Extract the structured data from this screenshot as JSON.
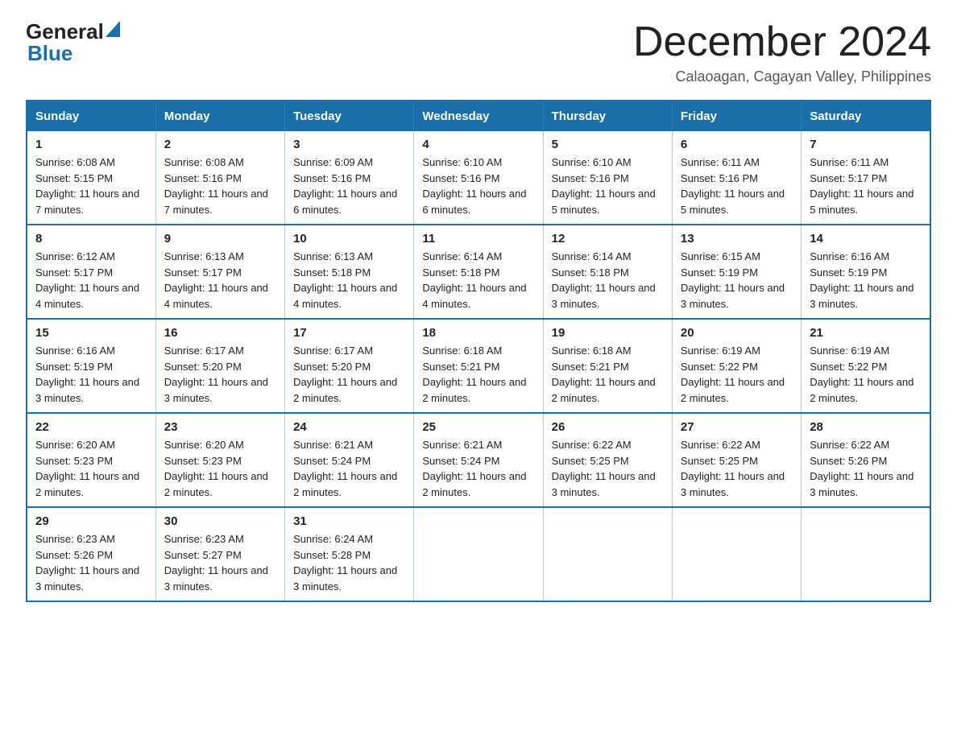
{
  "header": {
    "logo_general": "General",
    "logo_blue": "Blue",
    "month_title": "December 2024",
    "location": "Calaoagan, Cagayan Valley, Philippines"
  },
  "weekdays": [
    "Sunday",
    "Monday",
    "Tuesday",
    "Wednesday",
    "Thursday",
    "Friday",
    "Saturday"
  ],
  "weeks": [
    [
      {
        "day": "1",
        "sunrise": "6:08 AM",
        "sunset": "5:15 PM",
        "daylight": "11 hours and 7 minutes."
      },
      {
        "day": "2",
        "sunrise": "6:08 AM",
        "sunset": "5:16 PM",
        "daylight": "11 hours and 7 minutes."
      },
      {
        "day": "3",
        "sunrise": "6:09 AM",
        "sunset": "5:16 PM",
        "daylight": "11 hours and 6 minutes."
      },
      {
        "day": "4",
        "sunrise": "6:10 AM",
        "sunset": "5:16 PM",
        "daylight": "11 hours and 6 minutes."
      },
      {
        "day": "5",
        "sunrise": "6:10 AM",
        "sunset": "5:16 PM",
        "daylight": "11 hours and 5 minutes."
      },
      {
        "day": "6",
        "sunrise": "6:11 AM",
        "sunset": "5:16 PM",
        "daylight": "11 hours and 5 minutes."
      },
      {
        "day": "7",
        "sunrise": "6:11 AM",
        "sunset": "5:17 PM",
        "daylight": "11 hours and 5 minutes."
      }
    ],
    [
      {
        "day": "8",
        "sunrise": "6:12 AM",
        "sunset": "5:17 PM",
        "daylight": "11 hours and 4 minutes."
      },
      {
        "day": "9",
        "sunrise": "6:13 AM",
        "sunset": "5:17 PM",
        "daylight": "11 hours and 4 minutes."
      },
      {
        "day": "10",
        "sunrise": "6:13 AM",
        "sunset": "5:18 PM",
        "daylight": "11 hours and 4 minutes."
      },
      {
        "day": "11",
        "sunrise": "6:14 AM",
        "sunset": "5:18 PM",
        "daylight": "11 hours and 4 minutes."
      },
      {
        "day": "12",
        "sunrise": "6:14 AM",
        "sunset": "5:18 PM",
        "daylight": "11 hours and 3 minutes."
      },
      {
        "day": "13",
        "sunrise": "6:15 AM",
        "sunset": "5:19 PM",
        "daylight": "11 hours and 3 minutes."
      },
      {
        "day": "14",
        "sunrise": "6:16 AM",
        "sunset": "5:19 PM",
        "daylight": "11 hours and 3 minutes."
      }
    ],
    [
      {
        "day": "15",
        "sunrise": "6:16 AM",
        "sunset": "5:19 PM",
        "daylight": "11 hours and 3 minutes."
      },
      {
        "day": "16",
        "sunrise": "6:17 AM",
        "sunset": "5:20 PM",
        "daylight": "11 hours and 3 minutes."
      },
      {
        "day": "17",
        "sunrise": "6:17 AM",
        "sunset": "5:20 PM",
        "daylight": "11 hours and 2 minutes."
      },
      {
        "day": "18",
        "sunrise": "6:18 AM",
        "sunset": "5:21 PM",
        "daylight": "11 hours and 2 minutes."
      },
      {
        "day": "19",
        "sunrise": "6:18 AM",
        "sunset": "5:21 PM",
        "daylight": "11 hours and 2 minutes."
      },
      {
        "day": "20",
        "sunrise": "6:19 AM",
        "sunset": "5:22 PM",
        "daylight": "11 hours and 2 minutes."
      },
      {
        "day": "21",
        "sunrise": "6:19 AM",
        "sunset": "5:22 PM",
        "daylight": "11 hours and 2 minutes."
      }
    ],
    [
      {
        "day": "22",
        "sunrise": "6:20 AM",
        "sunset": "5:23 PM",
        "daylight": "11 hours and 2 minutes."
      },
      {
        "day": "23",
        "sunrise": "6:20 AM",
        "sunset": "5:23 PM",
        "daylight": "11 hours and 2 minutes."
      },
      {
        "day": "24",
        "sunrise": "6:21 AM",
        "sunset": "5:24 PM",
        "daylight": "11 hours and 2 minutes."
      },
      {
        "day": "25",
        "sunrise": "6:21 AM",
        "sunset": "5:24 PM",
        "daylight": "11 hours and 2 minutes."
      },
      {
        "day": "26",
        "sunrise": "6:22 AM",
        "sunset": "5:25 PM",
        "daylight": "11 hours and 3 minutes."
      },
      {
        "day": "27",
        "sunrise": "6:22 AM",
        "sunset": "5:25 PM",
        "daylight": "11 hours and 3 minutes."
      },
      {
        "day": "28",
        "sunrise": "6:22 AM",
        "sunset": "5:26 PM",
        "daylight": "11 hours and 3 minutes."
      }
    ],
    [
      {
        "day": "29",
        "sunrise": "6:23 AM",
        "sunset": "5:26 PM",
        "daylight": "11 hours and 3 minutes."
      },
      {
        "day": "30",
        "sunrise": "6:23 AM",
        "sunset": "5:27 PM",
        "daylight": "11 hours and 3 minutes."
      },
      {
        "day": "31",
        "sunrise": "6:24 AM",
        "sunset": "5:28 PM",
        "daylight": "11 hours and 3 minutes."
      },
      null,
      null,
      null,
      null
    ]
  ],
  "labels": {
    "sunrise_prefix": "Sunrise: ",
    "sunset_prefix": "Sunset: ",
    "daylight_prefix": "Daylight: "
  }
}
